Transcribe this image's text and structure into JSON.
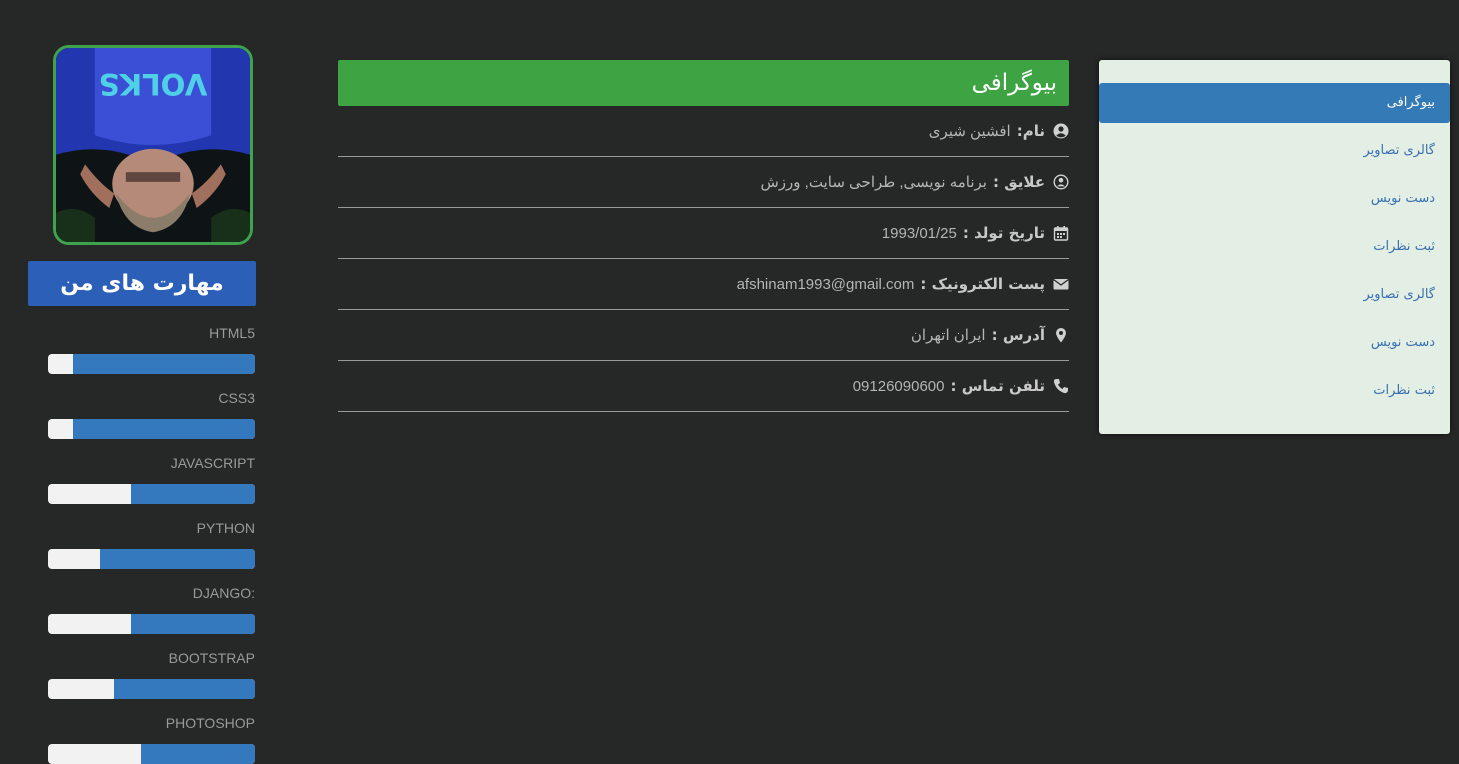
{
  "sidebar": {
    "items": [
      {
        "label": "بیوگرافی",
        "active": true
      },
      {
        "label": "گالری تصاویر",
        "active": false
      },
      {
        "label": "دست نویس",
        "active": false
      },
      {
        "label": "ثبت نظرات",
        "active": false
      },
      {
        "label": "گالری تصاویر",
        "active": false
      },
      {
        "label": "دست نویس",
        "active": false
      },
      {
        "label": "ثبت نظرات",
        "active": false
      }
    ]
  },
  "bio": {
    "title": "بیوگرافی",
    "rows": [
      {
        "icon": "user-circle-icon",
        "label": "نام:",
        "value": "افشین شیری"
      },
      {
        "icon": "user-circle-outline-icon",
        "label": "علایق :",
        "value": "برنامه نویسی, طراحی سایت, ورزش"
      },
      {
        "icon": "calendar-icon",
        "label": "تاریخ تولد :",
        "value": "1993/01/25"
      },
      {
        "icon": "envelope-icon",
        "label": "پست الکترونیک :",
        "value": "afshinam1993@gmail.com"
      },
      {
        "icon": "map-marker-icon",
        "label": "آدرس :",
        "value": "ایران اتهران"
      },
      {
        "icon": "phone-icon",
        "label": "تلفن تماس :",
        "value": "09126090600"
      }
    ]
  },
  "skills": {
    "title": "مهارت های من",
    "items": [
      {
        "name": "HTML5",
        "level": 0.88
      },
      {
        "name": "CSS3",
        "level": 0.88
      },
      {
        "name": "JAVASCRIPT",
        "level": 0.6
      },
      {
        "name": "PYTHON",
        "level": 0.75
      },
      {
        "name": "DJANGO:",
        "level": 0.6
      },
      {
        "name": "BOOTSTRAP",
        "level": 0.68
      },
      {
        "name": "PHOTOSHOP",
        "level": 0.55
      }
    ]
  },
  "colors": {
    "background": "#262727",
    "bio_header": "#3ea443",
    "skills_header": "#2b5fb8",
    "skill_fill": "#3478bd",
    "sidebar_bg": "#e3efe5",
    "sidebar_active": "#337ab7",
    "avatar_border": "#3fa34d"
  }
}
